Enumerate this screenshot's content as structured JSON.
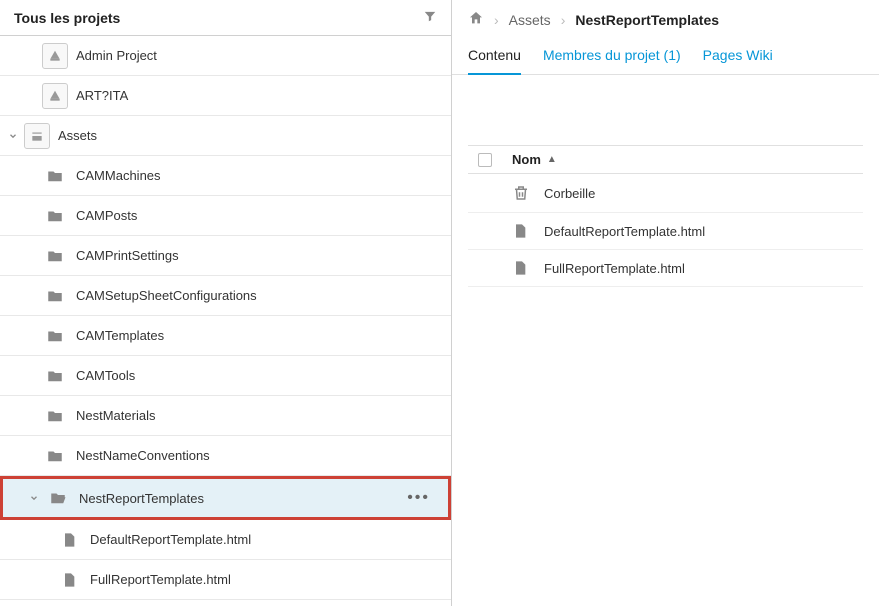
{
  "left": {
    "title": "Tous les projets",
    "tree": [
      {
        "label": "Admin Project"
      },
      {
        "label": "ART?ITA"
      },
      {
        "label": "Assets"
      },
      {
        "label": "CAMMachines"
      },
      {
        "label": "CAMPosts"
      },
      {
        "label": "CAMPrintSettings"
      },
      {
        "label": "CAMSetupSheetConfigurations"
      },
      {
        "label": "CAMTemplates"
      },
      {
        "label": "CAMTools"
      },
      {
        "label": "NestMaterials"
      },
      {
        "label": "NestNameConventions"
      },
      {
        "label": "NestReportTemplates"
      },
      {
        "label": "DefaultReportTemplate.html"
      },
      {
        "label": "FullReportTemplate.html"
      }
    ]
  },
  "breadcrumb": {
    "item1": "Assets",
    "item2": "NestReportTemplates"
  },
  "tabs": {
    "content": "Contenu",
    "members": "Membres du projet (1)",
    "wiki": "Pages Wiki"
  },
  "table": {
    "header_name": "Nom",
    "rows": [
      {
        "label": "Corbeille"
      },
      {
        "label": "DefaultReportTemplate.html"
      },
      {
        "label": "FullReportTemplate.html"
      }
    ]
  }
}
